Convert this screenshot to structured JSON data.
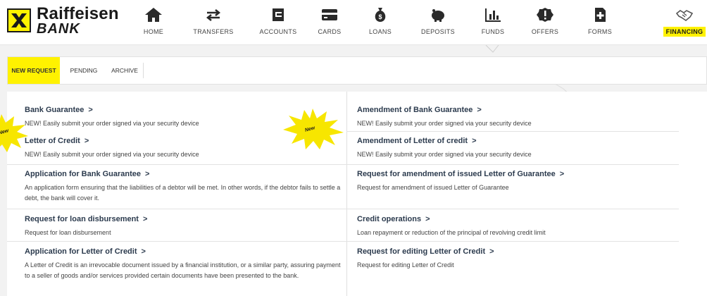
{
  "brand": {
    "line1": "Raiffeisen",
    "line2": "BANK",
    "accent": "#fff200"
  },
  "nav": {
    "items": [
      {
        "label": "HOME",
        "icon": "house-icon"
      },
      {
        "label": "TRANSFERS",
        "icon": "transfer-arrows-icon"
      },
      {
        "label": "ACCOUNTS",
        "icon": "account-icon"
      },
      {
        "label": "CARDS",
        "icon": "card-icon"
      },
      {
        "label": "LOANS",
        "icon": "money-bag-icon"
      },
      {
        "label": "DEPOSITS",
        "icon": "piggy-bank-icon"
      },
      {
        "label": "FUNDS",
        "icon": "bar-chart-icon"
      },
      {
        "label": "OFFERS",
        "icon": "badge-icon"
      },
      {
        "label": "FORMS",
        "icon": "form-add-icon"
      },
      {
        "label": "FINANCING",
        "icon": "handshake-icon",
        "active": true
      }
    ]
  },
  "tabs": [
    {
      "label": "NEW REQUEST",
      "active": true
    },
    {
      "label": "PENDING"
    },
    {
      "label": "ARCHIVE"
    }
  ],
  "badges": {
    "new": "New"
  },
  "requests": {
    "left": [
      {
        "title": "Bank Guarantee",
        "desc": "NEW! Easily submit your order signed via your security device"
      },
      {
        "title": "Letter of Credit",
        "desc": "NEW! Easily submit your order signed via your security device"
      },
      {
        "title": "Application for Bank Guarantee",
        "desc": "An application form ensuring that the liabilities of a debtor will be met. In other words, if the debtor fails to settle a debt, the bank will cover it."
      },
      {
        "title": "Request for loan disbursement",
        "desc": "Request for loan disbursement"
      },
      {
        "title": "Application for Letter of Credit",
        "desc": "A Letter of Credit is an irrevocable document issued by a financial institution, or a similar party, assuring payment to a seller of goods and/or services provided certain documents have been presented to the bank."
      }
    ],
    "right": [
      {
        "title": "Amendment of Bank Guarantee",
        "desc": "NEW! Easily submit your order signed via your security device"
      },
      {
        "title": "Amendment of Letter of credit",
        "desc": "NEW! Easily submit your order signed via your security device"
      },
      {
        "title": "Request for amendment of issued Letter of Guarantee",
        "desc": "Request for amendment of issued Letter of Guarantee"
      },
      {
        "title": "Credit operations",
        "desc": "Loan repayment or reduction of the principal of revolving credit limit"
      },
      {
        "title": "Request for editing Letter of Credit",
        "desc": "Request for editing Letter of Credit"
      }
    ]
  },
  "chevron": ">"
}
